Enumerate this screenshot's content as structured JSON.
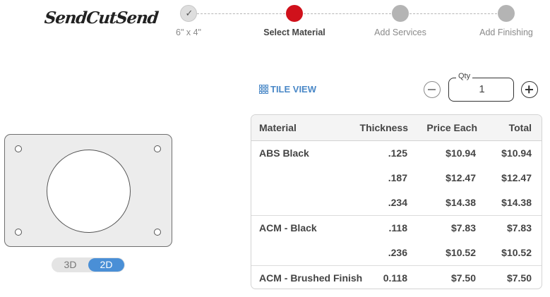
{
  "brand": {
    "logo_text": "SendCutSend"
  },
  "stepper": {
    "steps": [
      {
        "label": "6\" x 4\"",
        "state": "done"
      },
      {
        "label": "Select Material",
        "state": "active"
      },
      {
        "label": "Add Services",
        "state": "pending"
      },
      {
        "label": "Add Finishing",
        "state": "pending"
      }
    ],
    "check_icon": "check-icon"
  },
  "toolbar": {
    "tile_view_label": "TILE VIEW",
    "tile_view_icon": "grid-icon",
    "qty_label": "Qty",
    "qty_value": "1",
    "minus_icon": "minus-circle-icon",
    "plus_icon": "plus-circle-icon"
  },
  "preview": {
    "toggle": {
      "options": [
        "3D",
        "2D"
      ],
      "selected": "2D"
    }
  },
  "table": {
    "headers": {
      "material": "Material",
      "thickness": "Thickness",
      "price_each": "Price Each",
      "total": "Total"
    },
    "groups": [
      {
        "material": "ABS Black",
        "rows": [
          {
            "thickness": ".125",
            "price_each": "$10.94",
            "total": "$10.94"
          },
          {
            "thickness": ".187",
            "price_each": "$12.47",
            "total": "$12.47"
          },
          {
            "thickness": ".234",
            "price_each": "$14.38",
            "total": "$14.38"
          }
        ]
      },
      {
        "material": "ACM - Black",
        "rows": [
          {
            "thickness": ".118",
            "price_each": "$7.83",
            "total": "$7.83"
          },
          {
            "thickness": ".236",
            "price_each": "$10.52",
            "total": "$10.52"
          }
        ]
      },
      {
        "material": "ACM - Brushed Finish",
        "rows": [
          {
            "thickness": "0.118",
            "price_each": "$7.50",
            "total": "$7.50"
          }
        ]
      }
    ]
  },
  "colors": {
    "active_step": "#d0111b",
    "accent_blue": "#4a88c7",
    "toggle_selected": "#4a8fd6"
  }
}
